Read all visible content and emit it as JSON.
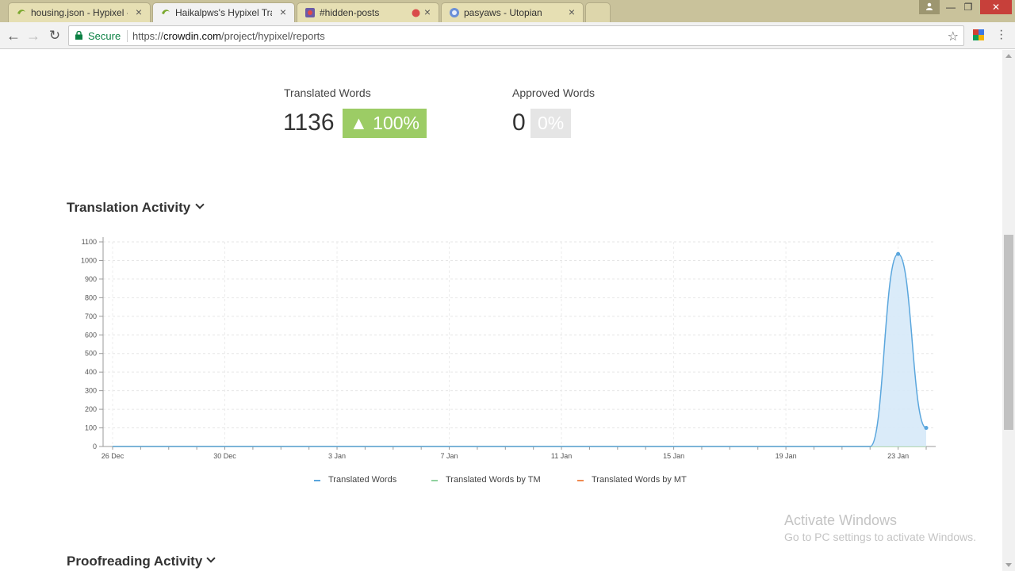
{
  "browser": {
    "tabs": [
      {
        "title": "housing.json - Hypixel - Cr",
        "active": false
      },
      {
        "title": "Haikalpws's Hypixel Trans",
        "active": true
      },
      {
        "title": "#hidden-posts",
        "active": false
      },
      {
        "title": "pasyaws - Utopian",
        "active": false
      }
    ],
    "secure_label": "Secure",
    "url_scheme": "https://",
    "url_host": "crowdin.com",
    "url_path": "/project/hypixel/reports"
  },
  "stats": {
    "translated_label": "Translated Words",
    "translated_value": "1136",
    "translated_percent": "▲ 100%",
    "approved_label": "Approved Words",
    "approved_value": "0",
    "approved_percent": "0%",
    "colors": {
      "translated_badge": "#9ccc65",
      "approved_badge": "#e5e5e5"
    }
  },
  "sections": {
    "translation_activity": "Translation Activity",
    "proofreading_activity": "Proofreading Activity"
  },
  "chart_data": {
    "type": "area",
    "title": "",
    "xlabel": "",
    "ylabel": "",
    "ylim": [
      0,
      1100
    ],
    "yticks": [
      0,
      100,
      200,
      300,
      400,
      500,
      600,
      700,
      800,
      900,
      1000,
      1100
    ],
    "x_tick_labels": [
      "26 Dec",
      "30 Dec",
      "3 Jan",
      "7 Jan",
      "11 Jan",
      "15 Jan",
      "19 Jan",
      "23 Jan"
    ],
    "x": [
      "26 Dec",
      "27 Dec",
      "28 Dec",
      "29 Dec",
      "30 Dec",
      "31 Dec",
      "1 Jan",
      "2 Jan",
      "3 Jan",
      "4 Jan",
      "5 Jan",
      "6 Jan",
      "7 Jan",
      "8 Jan",
      "9 Jan",
      "10 Jan",
      "11 Jan",
      "12 Jan",
      "13 Jan",
      "14 Jan",
      "15 Jan",
      "16 Jan",
      "17 Jan",
      "18 Jan",
      "19 Jan",
      "20 Jan",
      "21 Jan",
      "22 Jan",
      "23 Jan",
      "24 Jan"
    ],
    "series": [
      {
        "name": "Translated Words",
        "color": "#5aa6dd",
        "values": [
          0,
          0,
          0,
          0,
          0,
          0,
          0,
          0,
          0,
          0,
          0,
          0,
          0,
          0,
          0,
          0,
          0,
          0,
          0,
          0,
          0,
          0,
          0,
          0,
          0,
          0,
          0,
          0,
          1035,
          100
        ]
      },
      {
        "name": "Translated Words by TM",
        "color": "#8fd19e",
        "values": [
          0,
          0,
          0,
          0,
          0,
          0,
          0,
          0,
          0,
          0,
          0,
          0,
          0,
          0,
          0,
          0,
          0,
          0,
          0,
          0,
          0,
          0,
          0,
          0,
          0,
          0,
          0,
          0,
          0,
          0
        ]
      },
      {
        "name": "Translated Words by MT",
        "color": "#f08a50",
        "values": [
          0,
          0,
          0,
          0,
          0,
          0,
          0,
          0,
          0,
          0,
          0,
          0,
          0,
          0,
          0,
          0,
          0,
          0,
          0,
          0,
          0,
          0,
          0,
          0,
          0,
          0,
          0,
          0,
          0,
          0
        ]
      }
    ],
    "grid": true,
    "legend": "bottom"
  },
  "watermark": {
    "line1": "Activate Windows",
    "line2": "Go to PC settings to activate Windows."
  }
}
